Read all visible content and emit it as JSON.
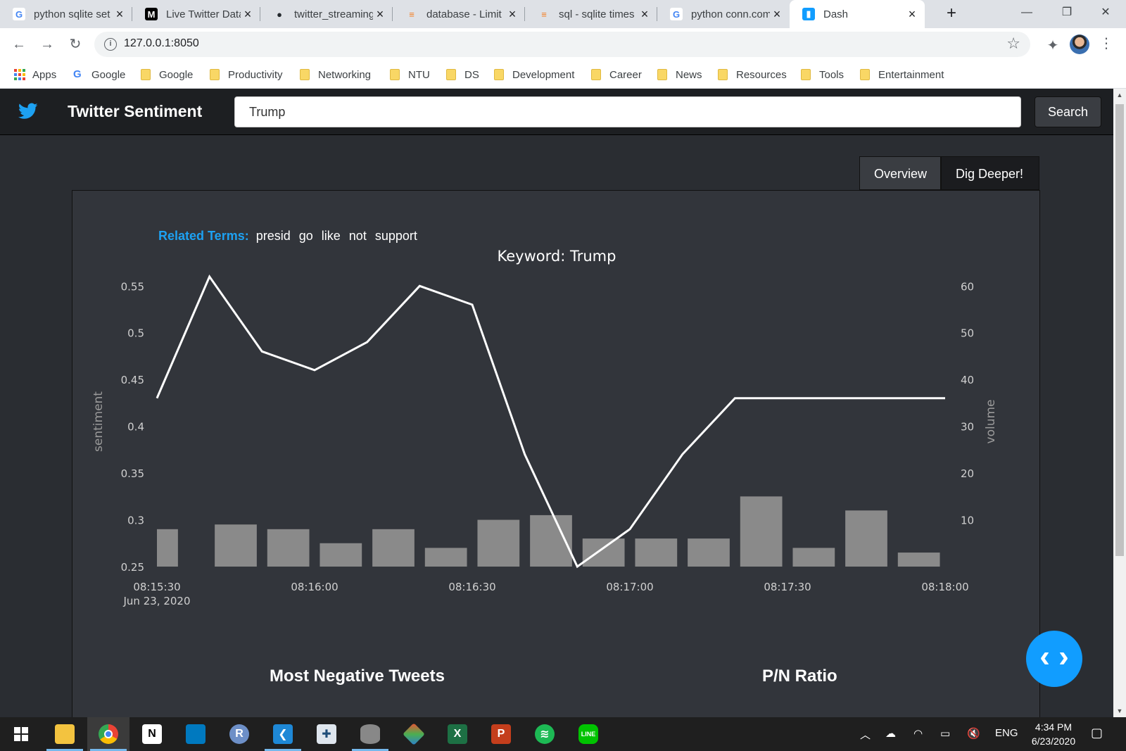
{
  "browser": {
    "tabs": [
      {
        "title": "python sqlite set",
        "icon": "google-icon",
        "active": false
      },
      {
        "title": "Live Twitter Data",
        "icon": "medium-icon",
        "active": false
      },
      {
        "title": "twitter_streaming",
        "icon": "github-icon",
        "active": false
      },
      {
        "title": "database - Limit",
        "icon": "stackoverflow-icon",
        "active": false
      },
      {
        "title": "sql - sqlite times",
        "icon": "stackoverflow-icon",
        "active": false
      },
      {
        "title": "python conn.com",
        "icon": "google-icon",
        "active": false
      },
      {
        "title": "Dash",
        "icon": "dash-icon",
        "active": true
      }
    ],
    "url": "127.0.0.1:8050",
    "bookmarks": [
      {
        "label": "Apps",
        "icon": "apps-grid-icon"
      },
      {
        "label": "Google",
        "icon": "google-icon"
      },
      {
        "label": "Google",
        "icon": "folder-icon"
      },
      {
        "label": "Productivity",
        "icon": "folder-icon"
      },
      {
        "label": "Networking",
        "icon": "folder-icon"
      },
      {
        "label": "NTU",
        "icon": "folder-icon"
      },
      {
        "label": "DS",
        "icon": "folder-icon"
      },
      {
        "label": "Development",
        "icon": "folder-icon"
      },
      {
        "label": "Career",
        "icon": "folder-icon"
      },
      {
        "label": "News",
        "icon": "folder-icon"
      },
      {
        "label": "Resources",
        "icon": "folder-icon"
      },
      {
        "label": "Tools",
        "icon": "folder-icon"
      },
      {
        "label": "Entertainment",
        "icon": "folder-icon"
      }
    ]
  },
  "app": {
    "brand": "Twitter Sentiment",
    "search_value": "Trump",
    "search_button": "Search",
    "view_tabs": [
      "Overview",
      "Dig Deeper!"
    ],
    "related_label": "Related Terms:",
    "related_terms": [
      "presid",
      "go",
      "like",
      "not",
      "support"
    ],
    "sections": {
      "left": "Most Negative Tweets",
      "right": "P/N Ratio"
    },
    "colors": {
      "accent": "#1da1f2",
      "line": "#ffffff",
      "bars": "#8a8a8a",
      "panel": "#32353b",
      "fab": "#119dff"
    }
  },
  "chart_data": {
    "type": "line",
    "title": "Keyword: Trump",
    "ylabel": "sentiment",
    "y2label": "volume",
    "x_ticks": [
      "08:15:30",
      "08:16:00",
      "08:16:30",
      "08:17:00",
      "08:17:30",
      "08:18:00"
    ],
    "x_tick_date": "Jun 23, 2020",
    "x": [
      "08:15:30",
      "08:15:40",
      "08:15:50",
      "08:16:00",
      "08:16:10",
      "08:16:20",
      "08:16:30",
      "08:16:40",
      "08:16:50",
      "08:17:00",
      "08:17:10",
      "08:17:20",
      "08:17:30",
      "08:17:40",
      "08:17:50",
      "08:18:00"
    ],
    "series": [
      {
        "name": "sentiment",
        "axis": "left",
        "type": "line",
        "values": [
          0.43,
          0.56,
          0.48,
          0.46,
          0.49,
          0.55,
          0.53,
          0.37,
          0.25,
          0.29,
          0.37,
          0.43,
          0.43,
          0.43,
          0.43,
          0.43
        ]
      },
      {
        "name": "volume",
        "axis": "right",
        "type": "bar",
        "values": [
          8,
          9,
          8,
          5,
          8,
          4,
          10,
          11,
          6,
          6,
          6,
          15,
          4,
          12,
          3
        ]
      }
    ],
    "y_ticks": [
      "0.25",
      "0.3",
      "0.35",
      "0.4",
      "0.45",
      "0.5",
      "0.55"
    ],
    "y2_ticks": [
      "10",
      "20",
      "30",
      "40",
      "50",
      "60"
    ],
    "ylim": [
      0.25,
      0.56
    ],
    "y2lim": [
      0,
      62
    ]
  }
}
